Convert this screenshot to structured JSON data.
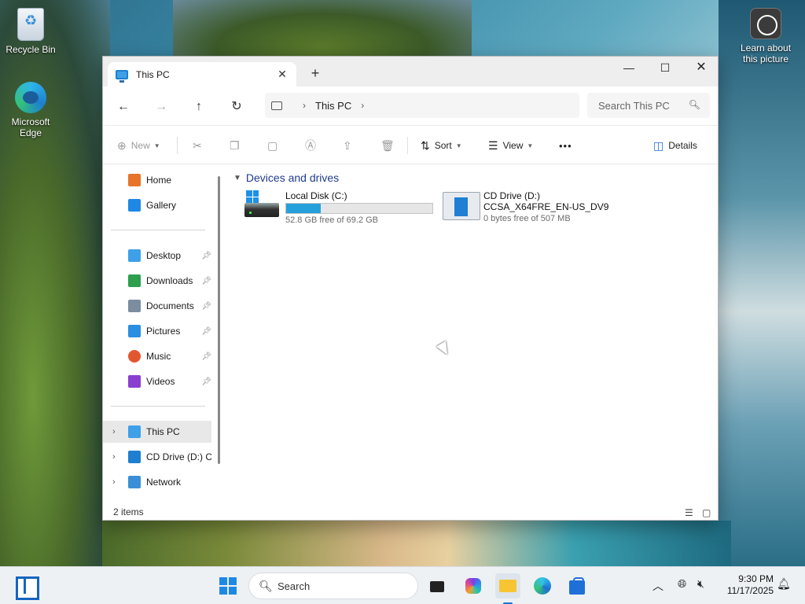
{
  "desktop": {
    "icons": [
      {
        "label": "Recycle Bin",
        "icon": "recycle-bin-icon"
      },
      {
        "label": "Microsoft Edge",
        "icon": "edge-icon"
      },
      {
        "label": "Learn about this picture",
        "icon": "learn-picture-icon"
      }
    ]
  },
  "window": {
    "tab_title": "This PC",
    "new_tab": "+",
    "controls": {
      "minimize": "—",
      "maximize": "☐",
      "close": "✕"
    },
    "nav": {
      "back": "←",
      "forward": "→",
      "up": "↑",
      "refresh": "↻"
    },
    "breadcrumb": {
      "items": [
        "This PC"
      ],
      "sep": "›"
    },
    "search": {
      "placeholder": "Search This PC"
    },
    "toolbar": {
      "new_label": "New",
      "sort_label": "Sort",
      "view_label": "View",
      "more_label": "•••",
      "details_label": "Details"
    },
    "navpane": {
      "items": [
        {
          "label": "Home",
          "icon": "home-icon",
          "color": "#e8742a"
        },
        {
          "label": "Gallery",
          "icon": "gallery-icon",
          "color": "#1e88e5"
        },
        {
          "label": "Desktop",
          "icon": "desktop-folder-icon",
          "color": "#3ea0e8"
        },
        {
          "label": "Downloads",
          "icon": "downloads-icon",
          "color": "#2e9e4f"
        },
        {
          "label": "Documents",
          "icon": "documents-icon",
          "color": "#7c8da0"
        },
        {
          "label": "Pictures",
          "icon": "pictures-icon",
          "color": "#2a8fe0"
        },
        {
          "label": "Music",
          "icon": "music-icon",
          "color": "#e4572e"
        },
        {
          "label": "Videos",
          "icon": "videos-icon",
          "color": "#8a3fd0"
        },
        {
          "label": "This PC",
          "icon": "this-pc-icon",
          "color": "#3ea0e8"
        },
        {
          "label": "CD Drive (D:) CC",
          "icon": "cd-drive-icon",
          "color": "#1e7fd0"
        },
        {
          "label": "Network",
          "icon": "network-icon",
          "color": "#3b8fd6"
        }
      ]
    },
    "content": {
      "group_title": "Devices and drives",
      "drives": [
        {
          "name": "Local Disk (C:)",
          "free_text": "52.8 GB free of 69.2 GB",
          "used_fraction": 0.237
        },
        {
          "name": "CD Drive (D:)",
          "volume": "CCSA_X64FRE_EN-US_DV9",
          "free_text": "0 bytes free of 507 MB"
        }
      ]
    },
    "status": {
      "item_count": "2 items"
    }
  },
  "taskbar": {
    "search_placeholder": "Search",
    "clock_time": "9:30 PM",
    "clock_date": "11/17/2025"
  },
  "colors": {
    "accent": "#1e88e5",
    "progress_fill": "#26a0da",
    "group_header": "#1f3b8f"
  }
}
